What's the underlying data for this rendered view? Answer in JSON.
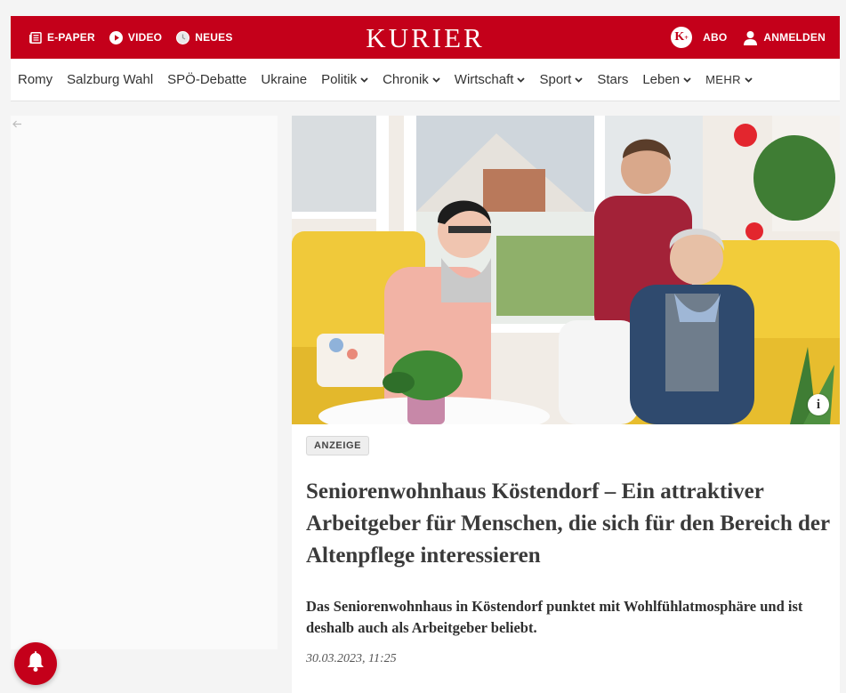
{
  "topbar": {
    "epaper_label": "E-PAPER",
    "video_label": "VIDEO",
    "neues_label": "NEUES",
    "logo_text": "KURIER",
    "kplus_text": "K",
    "kplus_sup": "+",
    "abo_label": "ABO",
    "login_label": "ANMELDEN"
  },
  "nav": {
    "items": [
      {
        "label": "Romy"
      },
      {
        "label": "Salzburg Wahl"
      },
      {
        "label": "SPÖ-Debatte"
      },
      {
        "label": "Ukraine"
      },
      {
        "label": "Politik"
      },
      {
        "label": "Chronik"
      },
      {
        "label": "Wirtschaft"
      },
      {
        "label": "Sport"
      },
      {
        "label": "Stars"
      },
      {
        "label": "Leben"
      },
      {
        "label": "MEHR"
      }
    ]
  },
  "article": {
    "badge": "ANZEIGE",
    "headline": "Seniorenwohnhaus Köstendorf – Ein attraktiver Arbeitgeber für Menschen, die sich für den Bereich der Altenpflege interessieren",
    "lead": "Das Seniorenwohnhaus in Köstendorf punktet mit Wohlfühlatmosphäre und ist deshalb auch als Arbeitgeber beliebt.",
    "date": "30.03.2023, 11:25",
    "info_glyph": "i"
  },
  "colors": {
    "brand_red": "#c4001a",
    "chair_yellow": "#f2cc3a"
  },
  "icons": {
    "epaper": "newspaper-icon",
    "video": "play-icon",
    "neues": "clock-icon",
    "user": "user-icon",
    "bell": "bell-icon",
    "back": "arrow-left-icon"
  }
}
